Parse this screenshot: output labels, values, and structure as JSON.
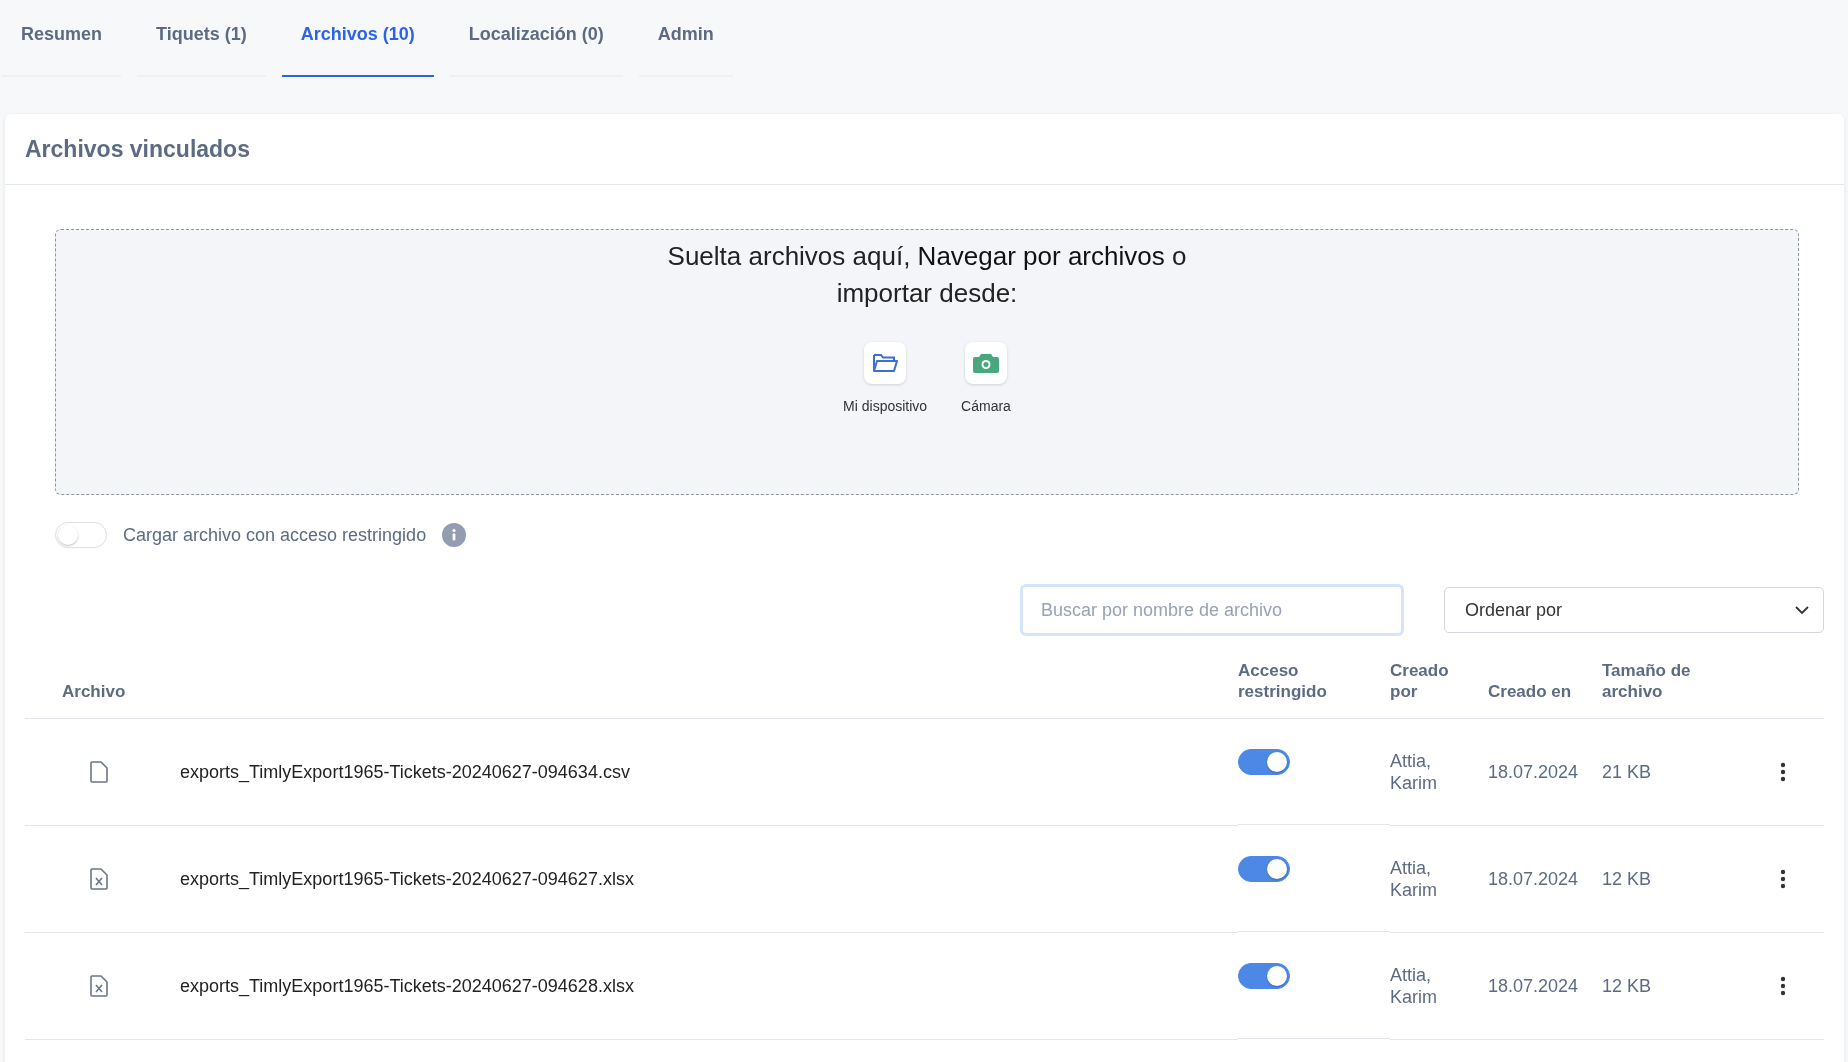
{
  "tabs": [
    {
      "label": "Resumen",
      "selected": false
    },
    {
      "label": "Tiquets (1)",
      "selected": false
    },
    {
      "label": "Archivos (10)",
      "selected": true
    },
    {
      "label": "Localización (0)",
      "selected": false
    },
    {
      "label": "Admin",
      "selected": false
    }
  ],
  "panel": {
    "title": "Archivos vinculados"
  },
  "dropzone": {
    "text_before": "Suelta archivos aquí, ",
    "link": "Navegar por archivos",
    "text_after": " o importar desde:",
    "sources": [
      {
        "kind": "device",
        "label": "Mi dispositivo"
      },
      {
        "kind": "camera",
        "label": "Cámara"
      }
    ]
  },
  "restricted_upload": {
    "label": "Cargar archivo con acceso restringido",
    "on": false
  },
  "search": {
    "placeholder": "Buscar por nombre de archivo"
  },
  "sort": {
    "value": "Ordenar por"
  },
  "table": {
    "columns": [
      "Archivo",
      "Acceso restringido",
      "Creado por",
      "Creado en",
      "Tamaño de archivo"
    ],
    "rows": [
      {
        "kind": "csv",
        "name": "exports_TimlyExport1965-Tickets-20240627-094634.csv",
        "restricted": true,
        "created_by": "Attia, Karim",
        "created_at": "18.07.2024",
        "size": "21 KB"
      },
      {
        "kind": "xlsx",
        "name": "exports_TimlyExport1965-Tickets-20240627-094627.xlsx",
        "restricted": true,
        "created_by": "Attia, Karim",
        "created_at": "18.07.2024",
        "size": "12 KB"
      },
      {
        "kind": "xlsx",
        "name": "exports_TimlyExport1965-Tickets-20240627-094628.xlsx",
        "restricted": true,
        "created_by": "Attia, Karim",
        "created_at": "18.07.2024",
        "size": "12 KB"
      }
    ]
  }
}
